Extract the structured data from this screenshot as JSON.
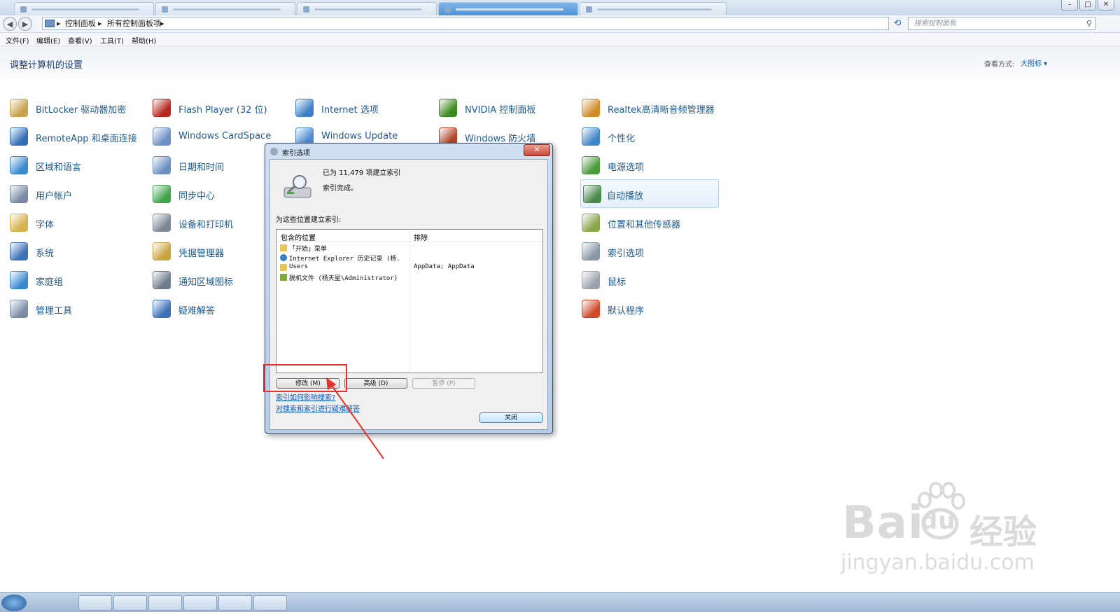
{
  "window": {
    "buttons": [
      "–",
      "□",
      "✕"
    ]
  },
  "address": {
    "crumbs": [
      "控制面板",
      "▸",
      "所有控制面板项",
      "▸"
    ],
    "search_placeholder": "搜索控制面板"
  },
  "menu": [
    "文件(F)",
    "编辑(E)",
    "查看(V)",
    "工具(T)",
    "帮助(H)"
  ],
  "page": {
    "heading": "调整计算机的设置",
    "view_by_label": "查看方式:",
    "view_by_value": "大图标 ▾"
  },
  "items": [
    {
      "label": "BitLocker 驱动器加密",
      "icon": "bitlocker-icon",
      "color": "#c8a24a"
    },
    {
      "label": "Flash Player (32 位)",
      "icon": "flash-icon",
      "color": "#b8261f"
    },
    {
      "label": "Internet 选项",
      "icon": "internet-options-icon",
      "color": "#3d7fc6"
    },
    {
      "label": "NVIDIA 控制面板",
      "icon": "nvidia-icon",
      "color": "#3c8a1e"
    },
    {
      "label": "Realtek高清晰音频管理器",
      "icon": "realtek-icon",
      "color": "#d08a2a"
    },
    {
      "label": "RemoteApp 和桌面连接",
      "icon": "remoteapp-icon",
      "color": "#2f6fb5"
    },
    {
      "label": "Windows CardSpace",
      "icon": "cardspace-icon",
      "color": "#6d8fc4"
    },
    {
      "label": "Windows Update",
      "icon": "windows-update-icon",
      "color": "#4d8bd0"
    },
    {
      "label": "Windows 防火墙",
      "icon": "firewall-icon",
      "color": "#b0452b"
    },
    {
      "label": "个性化",
      "icon": "personalization-icon",
      "color": "#3f86c9"
    },
    {
      "label": "区域和语言",
      "icon": "region-icon",
      "color": "#3b8ad0"
    },
    {
      "label": "日期和时间",
      "icon": "date-time-icon",
      "color": "#6a8fbf"
    },
    {
      "label": "电源选项",
      "icon": "power-icon",
      "color": "#4a9a3a"
    },
    {
      "label": "用户帐户",
      "icon": "user-accounts-icon",
      "color": "#7a8aa4"
    },
    {
      "label": "同步中心",
      "icon": "sync-center-icon",
      "color": "#3fa34a"
    },
    {
      "label": "自动播放",
      "icon": "autoplay-icon",
      "color": "#4a8a4a"
    },
    {
      "label": "字体",
      "icon": "fonts-icon",
      "color": "#d6b04a"
    },
    {
      "label": "设备和打印机",
      "icon": "printers-icon",
      "color": "#7c8794"
    },
    {
      "label": "位置和其他传感器",
      "icon": "sensors-icon",
      "color": "#8aa54a"
    },
    {
      "label": "系统",
      "icon": "system-icon",
      "color": "#3b72b8"
    },
    {
      "label": "凭据管理器",
      "icon": "credentials-icon",
      "color": "#c9a43e"
    },
    {
      "label": "索引选项",
      "icon": "indexing-icon",
      "color": "#8a97a6"
    },
    {
      "label": "家庭组",
      "icon": "homegroup-icon",
      "color": "#3b8ad0"
    },
    {
      "label": "通知区域图标",
      "icon": "notification-icon",
      "color": "#6d7b8c"
    },
    {
      "label": "鼠标",
      "icon": "mouse-icon",
      "color": "#9aa3ad"
    },
    {
      "label": "管理工具",
      "icon": "admin-tools-icon",
      "color": "#7b8ea6"
    },
    {
      "label": "疑难解答",
      "icon": "troubleshooting-icon",
      "color": "#3b6fb8"
    },
    {
      "label": "默认程序",
      "icon": "default-programs-icon",
      "color": "#d04a2a"
    }
  ],
  "dialog": {
    "title": "索引选项",
    "close": "✕",
    "status_count": "已为 11,479 项建立索引",
    "status_state": "索引完成。",
    "index_locations_label": "为这些位置建立索引:",
    "columns": [
      "包含的位置",
      "排除"
    ],
    "rows": [
      {
        "location": "「开始」菜单",
        "exclude": "",
        "icon": "folder-icon"
      },
      {
        "location": "Internet Explorer 历史记录 (杨...",
        "exclude": "",
        "icon": "ie-icon"
      },
      {
        "location": "Users",
        "exclude": "AppData; AppData",
        "icon": "folder-icon"
      },
      {
        "location": "脱机文件 (杨天星\\Administrator)",
        "exclude": "",
        "icon": "offline-files-icon"
      }
    ],
    "modify": "修改 (M)",
    "advanced": "高级 (D)",
    "pause": "暂停 (P)",
    "link1": "索引如何影响搜索?",
    "link2": "对搜索和索引进行疑难解答",
    "close_button": "关闭"
  },
  "watermark": {
    "brand": "Bai",
    "brand2": "du",
    "cn": "经验",
    "url": "jingyan.baidu.com"
  },
  "colors": {
    "accent_red": "#e5322d",
    "link": "#0a56c4",
    "item_text": "#1e5a90"
  }
}
